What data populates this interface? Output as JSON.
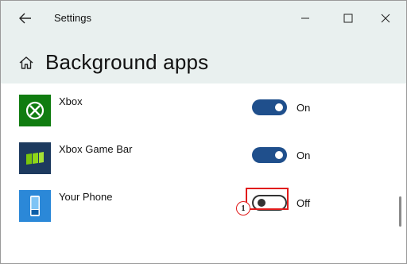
{
  "window": {
    "app_title": "Settings",
    "page_title": "Background apps"
  },
  "apps": [
    {
      "name": "Xbox",
      "state": "On",
      "enabled": true,
      "icon": "xbox-logo-icon",
      "tile_color": "#107c10"
    },
    {
      "name": "Xbox Game Bar",
      "state": "On",
      "enabled": true,
      "icon": "xbox-game-bar-icon",
      "tile_color": "#1d3a5f"
    },
    {
      "name": "Your Phone",
      "state": "Off",
      "enabled": false,
      "icon": "phone-icon",
      "tile_color": "#2b88d8"
    }
  ],
  "annotation": {
    "step": "1",
    "color": "#e11b1b"
  },
  "colors": {
    "toggle_on": "#1f4f8c",
    "header_bg": "#e9f0ef"
  }
}
